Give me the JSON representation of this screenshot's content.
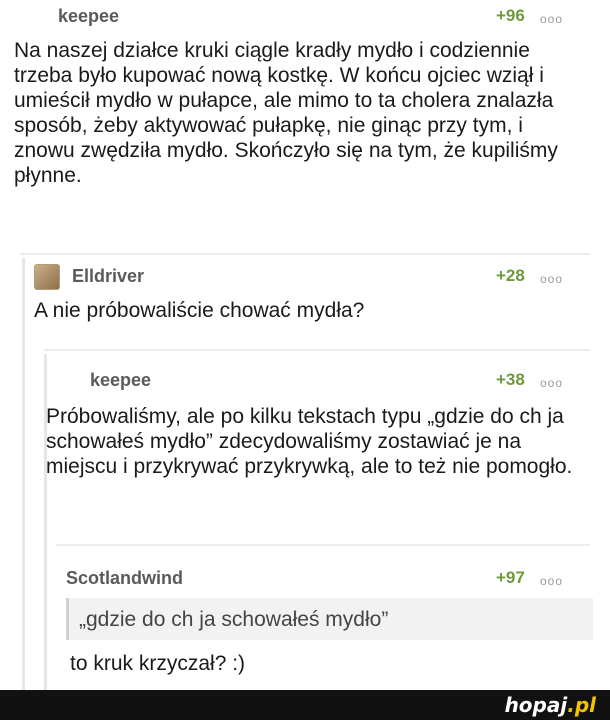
{
  "comments": [
    {
      "username": "keepee",
      "score": "+96",
      "menu": "ooo",
      "text": "Na naszej działce kruki ciągle kradły mydło i codziennie trzeba było kupować nową kostkę. W końcu ojciec wziął i umieścił mydło w pułapce, ale mimo to ta cholera znalazła sposób, żeby aktywować pułapkę, nie ginąc przy tym, i znowu zwędziła mydło. Skończyło się na tym, że kupiliśmy płynne."
    },
    {
      "username": "Elldriver",
      "score": "+28",
      "menu": "ooo",
      "text": "A nie próbowaliście chować mydła?"
    },
    {
      "username": "keepee",
      "score": "+38",
      "menu": "ooo",
      "text": "Próbowaliśmy, ale po kilku tekstach typu „gdzie do ch ja schowałeś mydło” zdecydowaliśmy zostawiać je na miejscu i przykrywać przykrywką, ale to też nie pomogło."
    },
    {
      "username": "Scotlandwind",
      "score": "+97",
      "menu": "ooo",
      "quote": "„gdzie do ch ja schowałeś mydło”",
      "text": "to kruk krzyczał? :)"
    }
  ],
  "footer": {
    "brand_main": "hopaj",
    "brand_tld": ".pl"
  },
  "colors": {
    "score": "#6e9a3c",
    "username": "#5a5a5a",
    "footer_bg": "#111111",
    "brand_accent": "#f2c200"
  }
}
